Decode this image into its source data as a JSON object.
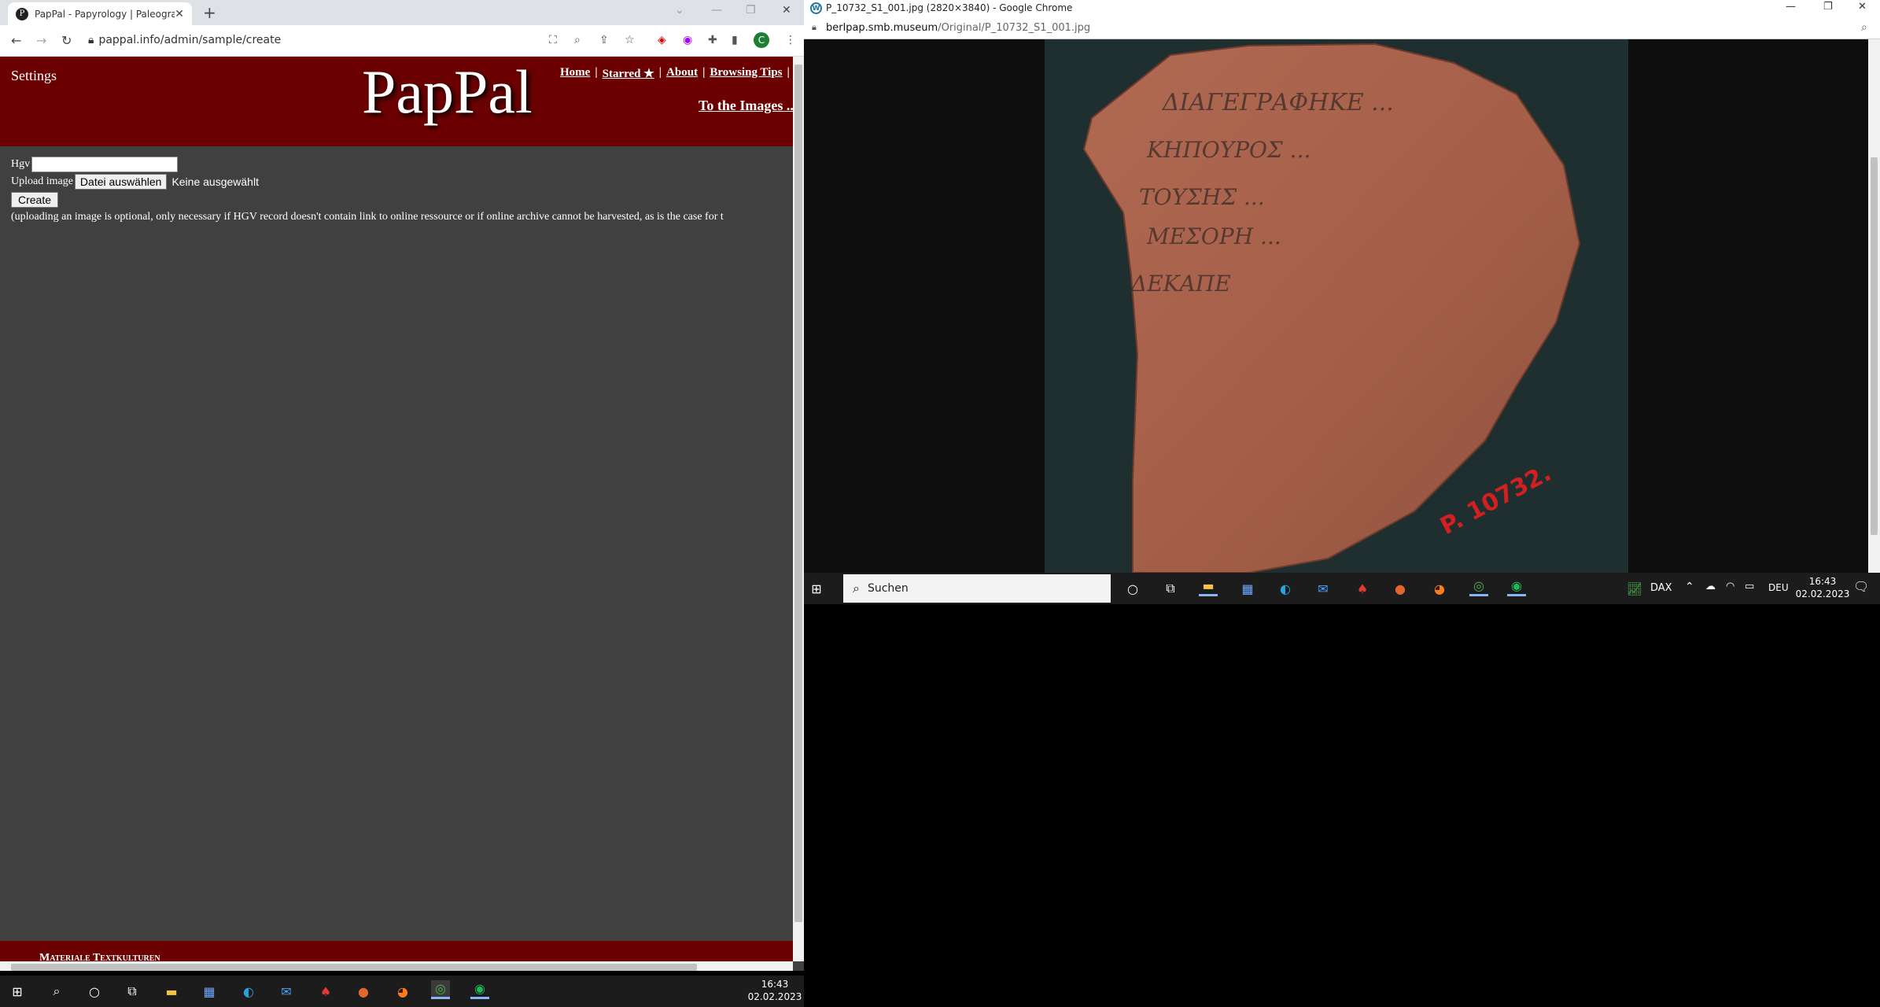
{
  "left_window": {
    "tab": {
      "favicon": "P",
      "title": "PapPal - Papyrology | Paleograph"
    },
    "address_url": "pappal.info/admin/sample/create",
    "profile_initial": "C",
    "site": {
      "settings_label": "Settings",
      "logo_text": "PapPal",
      "nav": [
        "Home",
        "Starred ★",
        "About",
        "Browsing Tips"
      ],
      "nav_separator": "|",
      "to_images_label": "To the Images ..."
    },
    "form": {
      "hgv_label": "Hgv",
      "hgv_value": "",
      "upload_label": "Upload image",
      "file_button_label": "Datei auswählen",
      "file_status": "Keine ausgewählt",
      "create_label": "Create",
      "note": "(uploading an image is optional, only necessary if HGV record doesn't contain link to online ressource or if online archive cannot be harvested, as is the case for t"
    },
    "footer_text": "Materiale Textkulturen"
  },
  "right_window": {
    "title": "P_10732_S1_001.jpg (2820×3840) - Google Chrome",
    "url_host": "berlpap.smb.museum",
    "url_path": "/Original/P_10732_S1_001.jpg",
    "ostracon": {
      "lines": [
        "ΔΙΑΓΕΓΡΑΦΗΚΕ ...",
        "ΚΗΠΟΥΡΟΣ ...",
        "ΤΟΥΣΗΣ ...",
        "ΜΕΣΟΡΗ ...",
        "ΔΕΚΑΠΕ"
      ],
      "inventory_stamp": "P. 10732."
    }
  },
  "taskbar_right": {
    "search_placeholder": "Suchen",
    "stock_label": "DAX",
    "language": "DEU",
    "time": "16:43",
    "date": "02.02.2023"
  },
  "taskbar_left": {
    "time": "16:43",
    "date": "02.02.2023"
  },
  "colors": {
    "site_red": "#6b0000",
    "page_bg": "#404040",
    "accent_blue": "#8ab4f8"
  },
  "icons": [
    "search-icon",
    "windows-start-icon",
    "cortana-icon",
    "task-view-icon",
    "file-explorer-icon",
    "store-icon",
    "edge-icon",
    "mail-icon",
    "acrobat-icon",
    "powerpoint-icon",
    "firefox-icon",
    "chrome-icon",
    "spotify-icon"
  ]
}
